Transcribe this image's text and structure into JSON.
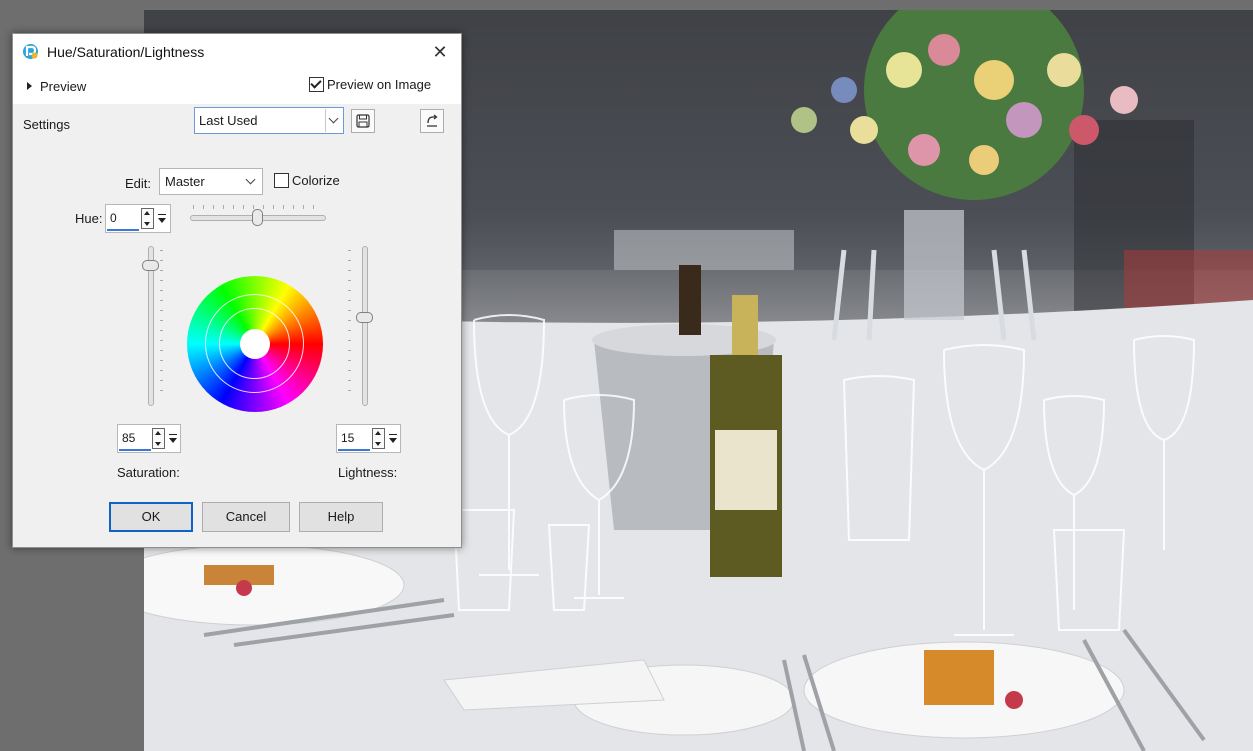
{
  "dialog": {
    "title": "Hue/Saturation/Lightness",
    "close_glyph": "✕",
    "preview_label": "Preview",
    "preview_on_image_label": "Preview on Image",
    "preview_on_image_checked": true,
    "settings_label": "Settings",
    "settings_value": "Last Used",
    "edit_label": "Edit:",
    "edit_value": "Master",
    "colorize_label": "Colorize",
    "colorize_checked": false,
    "hue_label": "Hue:",
    "hue_value": "0",
    "saturation_label": "Saturation:",
    "saturation_value": "85",
    "lightness_label": "Lightness:",
    "lightness_value": "15",
    "buttons": {
      "ok": "OK",
      "cancel": "Cancel",
      "help": "Help"
    },
    "accent_color": "#3c78d8"
  },
  "icons": [
    "app-logo-icon",
    "close-icon",
    "expand-arrow-icon",
    "save-preset-icon",
    "reset-defaults-icon",
    "chevron-down-icon",
    "spinner-arrows-icon"
  ],
  "canvas": {
    "description_color_background": "#6e6e6e"
  }
}
